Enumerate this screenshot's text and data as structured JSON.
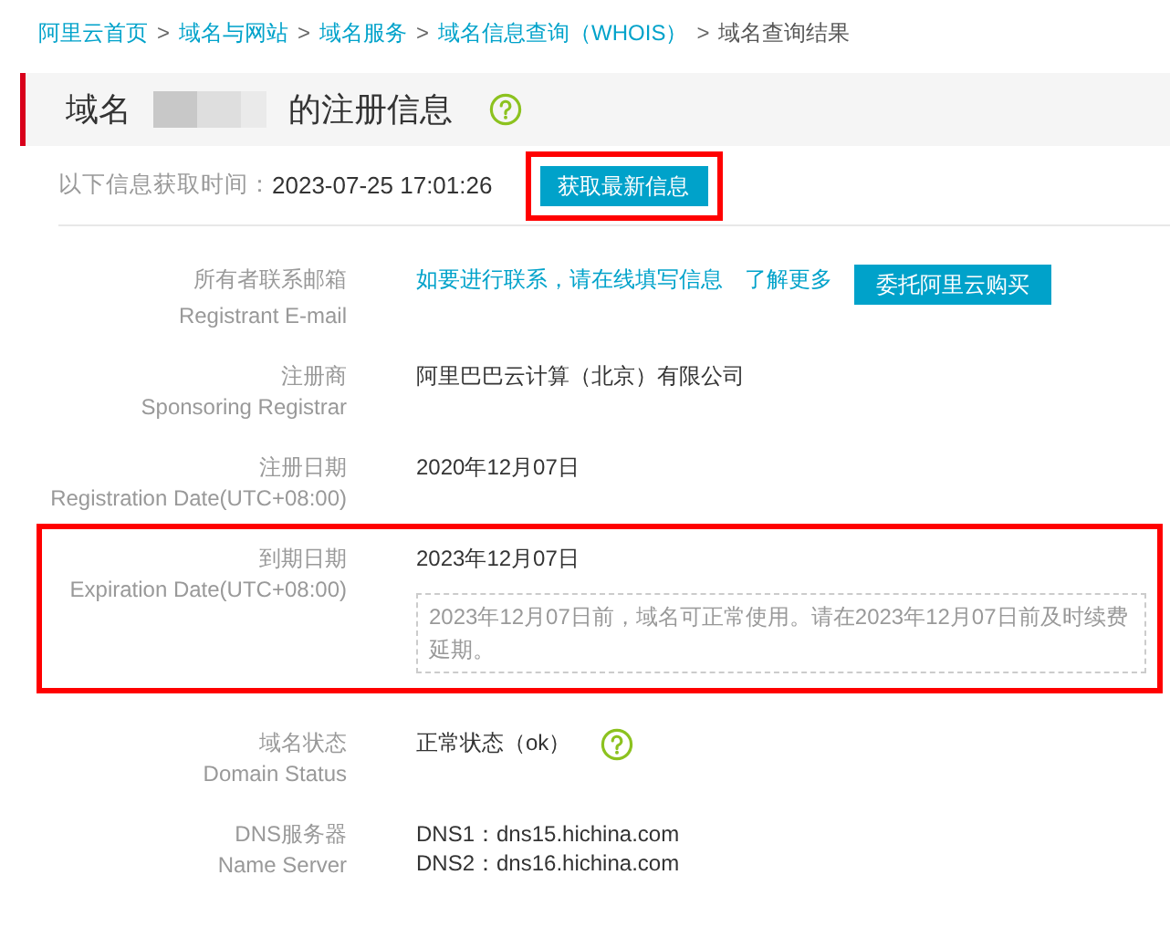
{
  "breadcrumb": [
    {
      "label": "阿里云首页",
      "kind": "link"
    },
    {
      "sep_before": ">",
      "label": "域名与网站",
      "kind": "link"
    },
    {
      "sep_before": ">",
      "label": "域名服务",
      "kind": "link"
    },
    {
      "sep_before": ">",
      "label": "域名信息查询（WHOIS）",
      "kind": "link"
    },
    {
      "sep_before": ">",
      "label": "域名查询结果",
      "kind": "current"
    }
  ],
  "header": {
    "prefix": "域名",
    "suffix": "的注册信息",
    "domain_redacted": true,
    "help_icon": true
  },
  "fetch": {
    "label": "以下信息获取时间：",
    "time": "2023-07-25 17:01:26",
    "button": "获取最新信息",
    "highlighted": true
  },
  "rows": [
    {
      "label": "所有者联系邮箱",
      "label_en": "Registrant E-mail",
      "highlighted": false,
      "values": [
        {
          "kind": "link",
          "text": "如要进行联系，请在线填写信息"
        },
        {
          "kind": "link",
          "text": "了解更多"
        },
        {
          "kind": "button",
          "text": "委托阿里云购买"
        }
      ]
    },
    {
      "label": "注册商",
      "label_en": "Sponsoring Registrar",
      "highlighted": false,
      "values": [
        {
          "kind": "text",
          "text": "阿里巴巴云计算（北京）有限公司"
        }
      ]
    },
    {
      "label": "注册日期",
      "label_en": "Registration Date(UTC+08:00)",
      "highlighted": false,
      "values": [
        {
          "kind": "text",
          "text": "2020年12月07日"
        }
      ]
    },
    {
      "label": "到期日期",
      "label_en": "Expiration Date(UTC+08:00)",
      "highlighted": true,
      "values": [
        {
          "kind": "text",
          "text": "2023年12月07日"
        },
        {
          "kind": "note",
          "text": "2023年12月07日前，域名可正常使用。请在2023年12月07日前及时续费延期。"
        }
      ]
    },
    {
      "label": "域名状态",
      "label_en": "Domain Status",
      "highlighted": false,
      "values": [
        {
          "kind": "text",
          "text": "正常状态（ok）"
        },
        {
          "kind": "help"
        }
      ]
    },
    {
      "label": "DNS服务器",
      "label_en": "Name Server",
      "highlighted": false,
      "values": [
        {
          "kind": "lines",
          "lines": [
            "DNS1：dns15.hichina.com",
            "DNS2：dns16.hichina.com"
          ]
        }
      ]
    }
  ]
}
